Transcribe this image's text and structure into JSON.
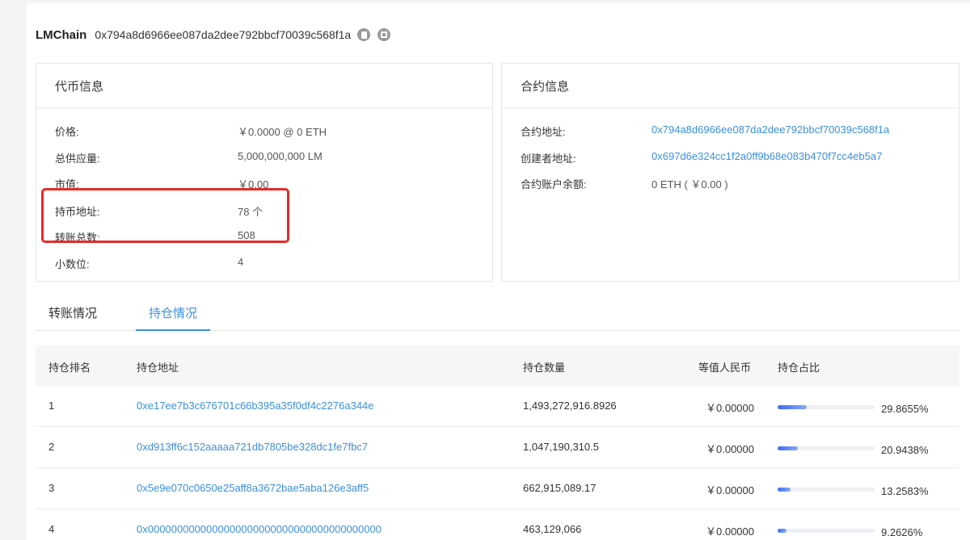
{
  "header": {
    "token_name": "LMChain",
    "token_address": "0x794a8d6966ee087da2dee792bbcf70039c568f1a"
  },
  "token_info": {
    "title": "代币信息",
    "rows": [
      {
        "label": "价格:",
        "value": "￥0.0000 @ 0 ETH"
      },
      {
        "label": "总供应量:",
        "value": "5,000,000,000 LM"
      },
      {
        "label": "市值:",
        "value": "￥0.00"
      },
      {
        "label": "持币地址:",
        "value": "78 个"
      },
      {
        "label": "转账总数:",
        "value": "508"
      },
      {
        "label": "小数位:",
        "value": "4"
      }
    ]
  },
  "contract_info": {
    "title": "合约信息",
    "rows": [
      {
        "label": "合约地址:",
        "value": "0x794a8d6966ee087da2dee792bbcf70039c568f1a"
      },
      {
        "label": "创建者地址:",
        "value": "0x697d6e324cc1f2a0ff9b68e083b470f7cc4eb5a7"
      },
      {
        "label": "合约账户余额:",
        "value": "0 ETH ( ￥0.00 )"
      }
    ]
  },
  "tabs": [
    {
      "label": "转账情况"
    },
    {
      "label": "持仓情况"
    }
  ],
  "table": {
    "headers": [
      "持仓排名",
      "持仓地址",
      "持仓数量",
      "等值人民币",
      "持仓占比"
    ],
    "rows": [
      {
        "rank": "1",
        "address": "0xe17ee7b3c676701c66b395a35f0df4c2276a344e",
        "amount": "1,493,272,916.8926",
        "cny": "￥0.00000",
        "pct_text": "29.8655%",
        "pct": 29.8655
      },
      {
        "rank": "2",
        "address": "0xd913ff6c152aaaaa721db7805be328dc1fe7fbc7",
        "amount": "1,047,190,310.5",
        "cny": "￥0.00000",
        "pct_text": "20.9438%",
        "pct": 20.9438
      },
      {
        "rank": "3",
        "address": "0x5e9e070c0650e25aff8a3672bae5aba126e3aff5",
        "amount": "662,915,089.17",
        "cny": "￥0.00000",
        "pct_text": "13.2583%",
        "pct": 13.2583
      },
      {
        "rank": "4",
        "address": "0x0000000000000000000000000000000000000000",
        "amount": "463,129,066",
        "cny": "￥0.00000",
        "pct_text": "9.2626%",
        "pct": 9.2626
      }
    ]
  },
  "colors": {
    "link": "#3b8fe0",
    "highlight": "#e52a2a",
    "bar": "#3a6df0"
  }
}
